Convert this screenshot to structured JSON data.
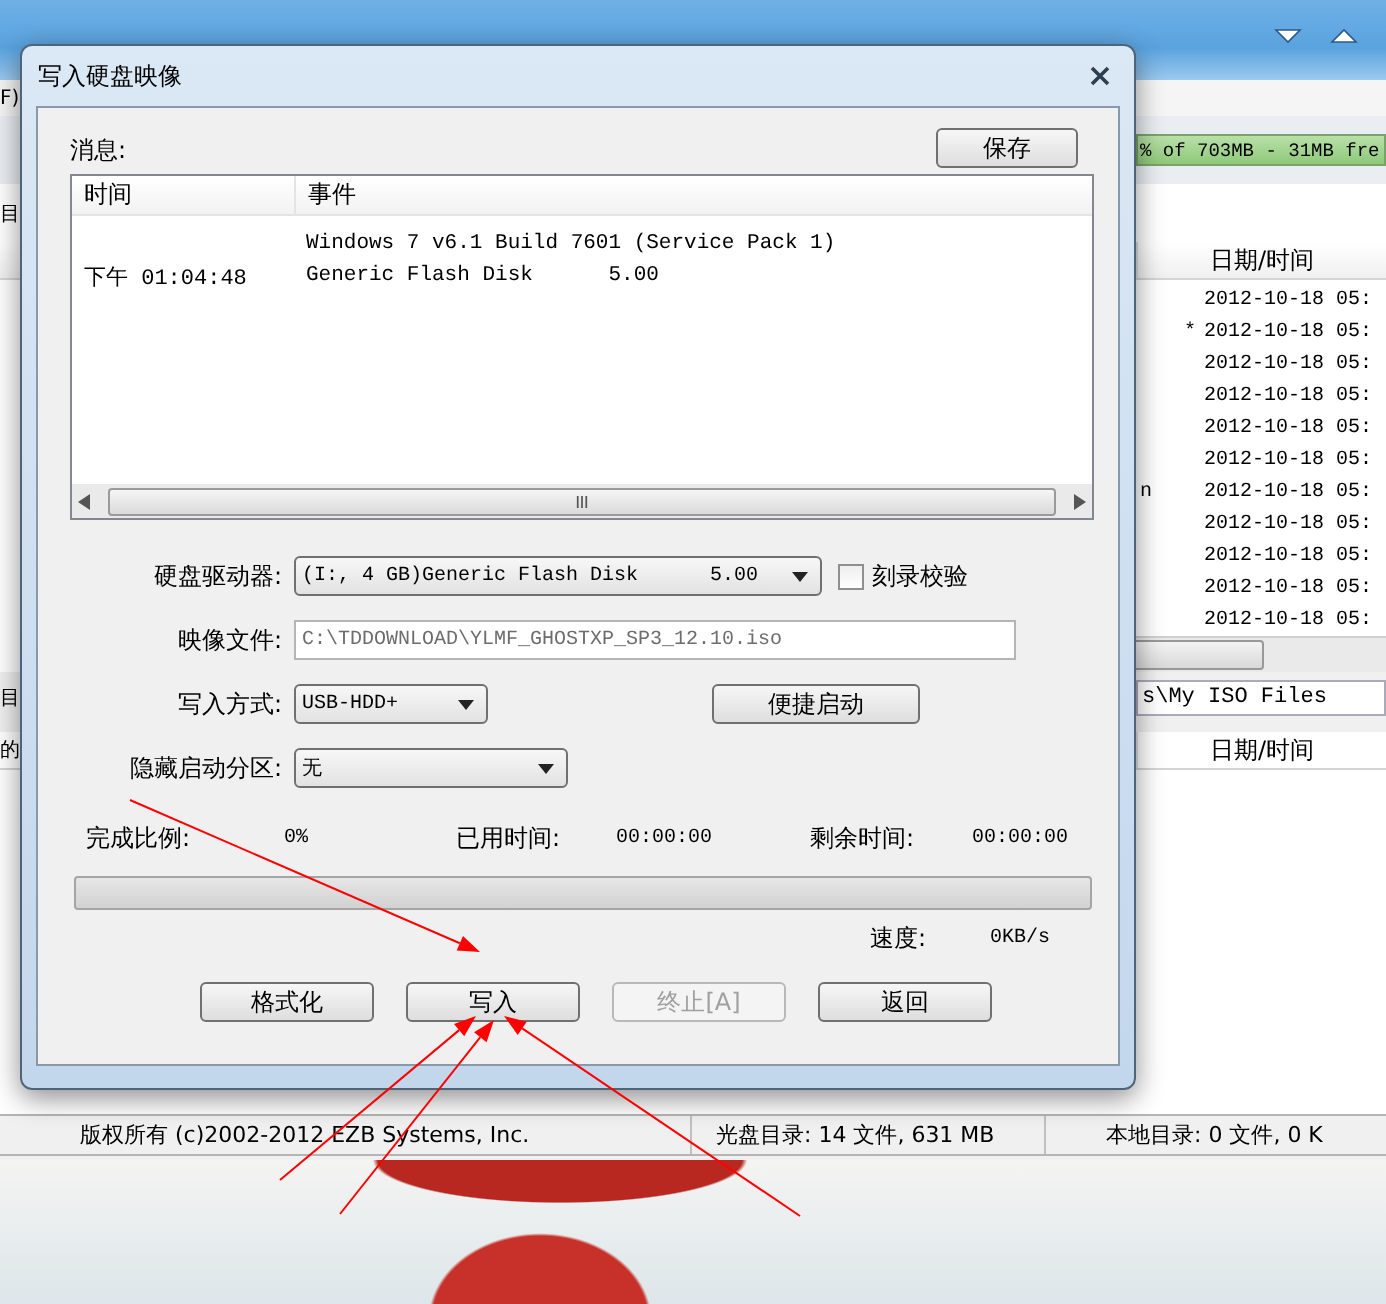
{
  "main_window": {
    "menu_fragment": "F)",
    "capacity_bar": "% of 703MB - 31MB fre",
    "sidebar_fragments": [
      "目",
      "目",
      "的"
    ],
    "upper_list": {
      "columns": [
        "日期/时间"
      ],
      "rows": [
        {
          "date": "2012-10-18 05:"
        },
        {
          "flag": "*",
          "date": "2012-10-18 05:"
        },
        {
          "date": "2012-10-18 05:"
        },
        {
          "date": "2012-10-18 05:"
        },
        {
          "date": "2012-10-18 05:"
        },
        {
          "date": "2012-10-18 05:"
        },
        {
          "name_fragment": "n",
          "date": "2012-10-18 05:"
        },
        {
          "date": "2012-10-18 05:"
        },
        {
          "date": "2012-10-18 05:"
        },
        {
          "date": "2012-10-18 05:"
        },
        {
          "date": "2012-10-18 05:"
        }
      ]
    },
    "path_fragment": "s\\My ISO Files",
    "lower_list": {
      "columns": [
        "日期/时间"
      ]
    },
    "status_bar": [
      "版权所有 (c)2002-2012 EZB Systems, Inc.",
      "光盘目录: 14 文件, 631 MB",
      "本地目录: 0 文件, 0 K"
    ]
  },
  "dialog": {
    "title": "写入硬盘映像",
    "messages_label": "消息:",
    "save_button": "保存",
    "log": {
      "columns": [
        "时间",
        "事件"
      ],
      "rows": [
        {
          "event": "Windows 7 v6.1 Build 7601 (Service Pack 1)"
        },
        {
          "time": "下午 01:04:48",
          "event": "Generic Flash Disk      5.00"
        }
      ]
    },
    "form": [
      {
        "label": "硬盘驱动器:",
        "kind": "dropdown",
        "value": "(I:, 4 GB)Generic Flash Disk      5.00",
        "extra": {
          "kind": "checkbox",
          "label": "刻录校验",
          "checked": false
        }
      },
      {
        "label": "映像文件:",
        "kind": "text",
        "value": "C:\\TDDOWNLOAD\\YLMF_GHOSTXP_SP3_12.10.iso",
        "disabled": true
      },
      {
        "label": "写入方式:",
        "kind": "dropdown",
        "value": "USB-HDD+",
        "extra": {
          "kind": "button",
          "label": "便捷启动"
        }
      },
      {
        "label": "隐藏启动分区:",
        "kind": "dropdown",
        "value": "无"
      }
    ],
    "stats": [
      {
        "label": "完成比例:",
        "value": "0%"
      },
      {
        "label": "已用时间:",
        "value": "00:00:00"
      },
      {
        "label": "剩余时间:",
        "value": "00:00:00"
      }
    ],
    "progress": {
      "level": 0
    },
    "speed": {
      "label": "速度:",
      "value": "0KB/s"
    },
    "buttons": [
      {
        "label": "格式化",
        "disabled": false
      },
      {
        "label": "写入",
        "disabled": false
      },
      {
        "label": "终止[A]",
        "disabled": true
      },
      {
        "label": "返回",
        "disabled": false
      }
    ]
  }
}
